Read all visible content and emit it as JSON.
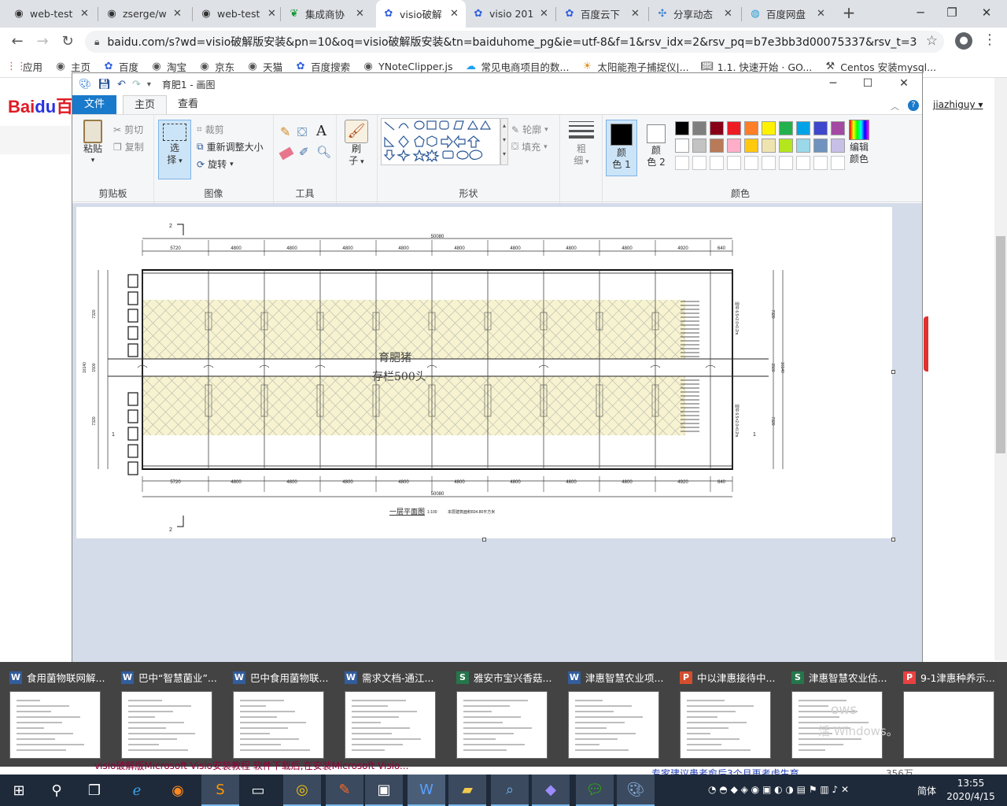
{
  "browser": {
    "tabs": [
      {
        "title": "web-test",
        "icon": "github-icon"
      },
      {
        "title": "zserge/w",
        "icon": "github-icon"
      },
      {
        "title": "web-test",
        "icon": "github-icon"
      },
      {
        "title": "集成商协",
        "icon": "green-leaf-icon"
      },
      {
        "title": "visio破解",
        "icon": "baidu-paw-icon",
        "active": true
      },
      {
        "title": "visio 201",
        "icon": "baidu-paw-icon"
      },
      {
        "title": "百度云下",
        "icon": "baidu-paw-icon"
      },
      {
        "title": "分享动态",
        "icon": "share-icon"
      },
      {
        "title": "百度网盘",
        "icon": "baidu-netdisk-icon"
      }
    ],
    "url": "baidu.com/s?wd=visio破解版安装&pn=10&oq=visio破解版安装&tn=baiduhome_pg&ie=utf-8&f=1&rsv_idx=2&rsv_pq=b7e3bb3d00075337&rsv_t=3f6...",
    "bookmarks": [
      {
        "label": "应用",
        "icon": "apps-grid-icon"
      },
      {
        "label": "主页",
        "icon": "globe-icon"
      },
      {
        "label": "百度",
        "icon": "baidu-paw-icon"
      },
      {
        "label": "淘宝",
        "icon": "globe-icon"
      },
      {
        "label": "京东",
        "icon": "globe-icon"
      },
      {
        "label": "天猫",
        "icon": "globe-icon"
      },
      {
        "label": "百度搜索",
        "icon": "baidu-paw-icon"
      },
      {
        "label": "YNoteClipper.js",
        "icon": "globe-icon"
      },
      {
        "label": "常见电商项目的数...",
        "icon": "cloud-icon"
      },
      {
        "label": "太阳能孢子捕捉仪|...",
        "icon": "sun-icon"
      },
      {
        "label": "1.1. 快速开始 · GO...",
        "icon": "book-icon"
      },
      {
        "label": "Centos 安装mysql...",
        "icon": "wrench-icon"
      }
    ]
  },
  "baidu": {
    "logo_a": "Bai",
    "logo_b": "du",
    "logo_c": "百",
    "user": "jiazhiguy",
    "bottom_left": "visio破解版Microsoft Visio安装教程 软件下载后,在安装Microsoft Visio...",
    "bottom_mid": "专家建议患者愈后3个月再考虑生育",
    "bottom_right": "356万"
  },
  "paint": {
    "title": "育肥1 - 画图",
    "tabs": {
      "file": "文件",
      "home": "主页",
      "view": "查看"
    },
    "clipboard": {
      "paste": "粘贴",
      "cut": "剪切",
      "copy": "复制",
      "label": "剪贴板"
    },
    "image": {
      "select_a": "选",
      "select_b": "择",
      "crop": "裁剪",
      "resize": "重新调整大小",
      "rotate": "旋转",
      "label": "图像"
    },
    "tools": {
      "label": "工具"
    },
    "brush": {
      "a": "刷",
      "b": "子"
    },
    "shapes": {
      "outline": "轮廓",
      "fill": "填充",
      "label": "形状"
    },
    "size": {
      "a": "粗",
      "b": "细"
    },
    "colors": {
      "color1_a": "颜",
      "color1_b": "色 1",
      "color2_a": "颜",
      "color2_b": "色 2",
      "edit_a": "编辑",
      "edit_b": "颜色",
      "label": "颜色"
    },
    "palette_row1": [
      "#000000",
      "#7f7f7f",
      "#880015",
      "#ed1c24",
      "#ff7f27",
      "#fff200",
      "#22b14c",
      "#00a2e8",
      "#3f48cc",
      "#a349a4"
    ],
    "palette_row2": [
      "#ffffff",
      "#c3c3c3",
      "#b97a57",
      "#ffaec9",
      "#ffc90e",
      "#efe4b0",
      "#b5e61d",
      "#99d9ea",
      "#7092be",
      "#c8bfe7"
    ],
    "color1": "#000000",
    "color2": "#ffffff"
  },
  "drawing": {
    "top_total": "50080",
    "bottom_total": "50080",
    "segments": [
      "5720",
      "4800",
      "4800",
      "4800",
      "4800",
      "4800",
      "4800",
      "4800",
      "4800",
      "4920",
      "640"
    ],
    "left_dims": [
      "7320",
      "1500",
      "7320"
    ],
    "left_total": "16140",
    "right_dims": [
      "7320",
      "1500",
      "7320"
    ],
    "right_total": "16140",
    "section_top": "2",
    "section_bottom": "2",
    "section_left": "1",
    "section_right": "1",
    "hand_line1": "育肥猪",
    "hand_line2": "存栏500头",
    "plan_title": "一层平面图",
    "plan_scale": "1:100",
    "plan_area": "本层建筑面积834.80平方米",
    "side_note_top": "湿帘 6.5×2.0×0.2m",
    "side_note_bottom": "湿帘 6.5×2.0×0.2m"
  },
  "thumbnails": [
    {
      "title": "食用菌物联网解...",
      "app": "word"
    },
    {
      "title": "巴中“智慧菌业”...",
      "app": "word"
    },
    {
      "title": "巴中食用菌物联...",
      "app": "word"
    },
    {
      "title": "需求文档-通江...",
      "app": "word"
    },
    {
      "title": "雅安市宝兴香菇...",
      "app": "excel"
    },
    {
      "title": "津惠智慧农业项...",
      "app": "word"
    },
    {
      "title": "中以津惠接待中...",
      "app": "powerpoint"
    },
    {
      "title": "津惠智慧农业估...",
      "app": "excel"
    },
    {
      "title": "9-1津惠种养示...",
      "app": "wps"
    }
  ],
  "watermark": {
    "line1": "ows",
    "line2": "活 Windows。"
  },
  "taskbar": {
    "ime": "简体",
    "time": "13:55",
    "date": "2020/4/15"
  }
}
